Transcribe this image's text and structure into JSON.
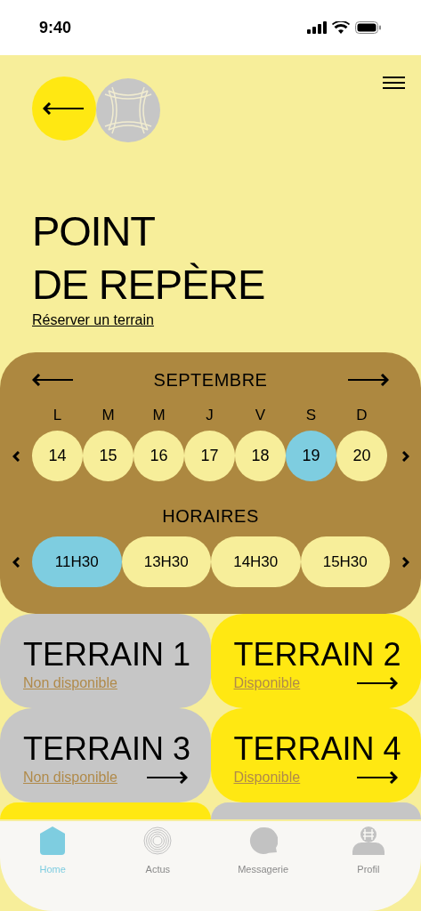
{
  "status_bar": {
    "time": "9:40"
  },
  "header": {
    "title_lines": [
      "POINT",
      "DE REPÈRE"
    ],
    "link": "Réserver un terrain"
  },
  "calendar": {
    "month": "SEPTEMBRE",
    "weekdays": [
      "L",
      "M",
      "M",
      "J",
      "V",
      "S",
      "D"
    ],
    "days": [
      {
        "label": "14",
        "selected": false
      },
      {
        "label": "15",
        "selected": false
      },
      {
        "label": "16",
        "selected": false
      },
      {
        "label": "17",
        "selected": false
      },
      {
        "label": "18",
        "selected": false
      },
      {
        "label": "19",
        "selected": true
      },
      {
        "label": "20",
        "selected": false
      }
    ],
    "times_title": "HORAIRES",
    "times": [
      {
        "label": "11H30",
        "selected": true
      },
      {
        "label": "13H30",
        "selected": false
      },
      {
        "label": "14H30",
        "selected": false
      },
      {
        "label": "15H30",
        "selected": false
      }
    ]
  },
  "courts": [
    {
      "name": "TERRAIN 1",
      "status": "Non disponible",
      "available": false,
      "arrow": false
    },
    {
      "name": "TERRAIN 2",
      "status": "Disponible",
      "available": true,
      "arrow": true
    },
    {
      "name": "TERRAIN 3",
      "status": "Non disponible",
      "available": false,
      "arrow": true
    },
    {
      "name": "TERRAIN 4",
      "status": "Disponible",
      "available": true,
      "arrow": true
    },
    {
      "available": true
    },
    {
      "available": false
    }
  ],
  "tab_bar": [
    {
      "label": "Home",
      "kind": "home",
      "selected": true
    },
    {
      "label": "Actus",
      "kind": "news",
      "selected": false
    },
    {
      "label": "Messagerie",
      "kind": "chat",
      "selected": false
    },
    {
      "label": "Profil",
      "kind": "profile",
      "selected": false
    }
  ]
}
